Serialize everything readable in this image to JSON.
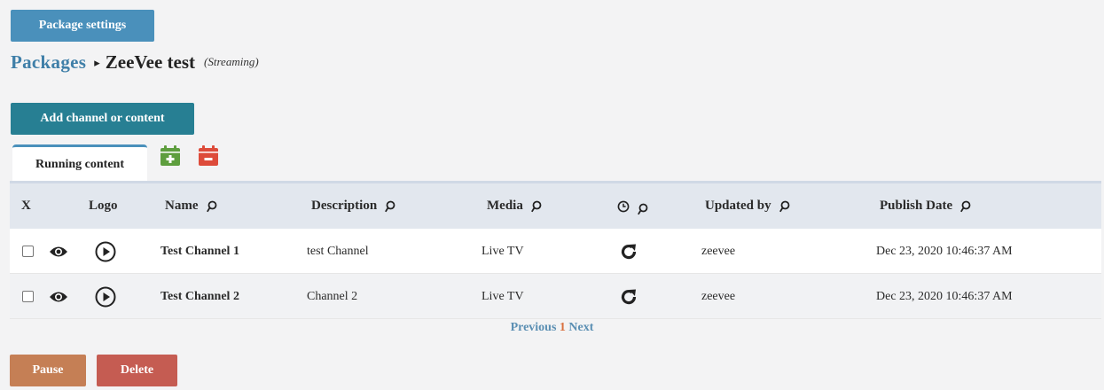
{
  "toolbar": {
    "package_settings_label": "Package settings",
    "add_label": "Add channel or content"
  },
  "breadcrumb": {
    "root": "Packages",
    "separator": "▸",
    "current": "ZeeVee test",
    "type": "(Streaming)"
  },
  "tabs": [
    {
      "label": "Running content",
      "active": true
    }
  ],
  "colors": {
    "primary": "#4a90bb",
    "teal": "#277f93",
    "pause": "#c57f55",
    "delete": "#c55c52",
    "calendar_add": "#5e9e3e",
    "calendar_remove": "#dd4b3a"
  },
  "table": {
    "columns": [
      "X",
      "Logo",
      "Name",
      "Description",
      "Media",
      "",
      "Updated by",
      "Publish Date"
    ],
    "rows": [
      {
        "name": "Test Channel 1",
        "description": "test Channel",
        "media": "Live TV",
        "updated_by": "zeevee",
        "publish_date": "Dec 23, 2020 10:46:37 AM"
      },
      {
        "name": "Test Channel 2",
        "description": "Channel 2",
        "media": "Live TV",
        "updated_by": "zeevee",
        "publish_date": "Dec 23, 2020 10:46:37 AM"
      }
    ]
  },
  "pagination": {
    "previous": "Previous",
    "current": "1",
    "next": "Next"
  },
  "actions": {
    "pause_label": "Pause",
    "delete_label": "Delete"
  },
  "icons": [
    "eye-icon",
    "play-icon",
    "refresh-icon",
    "search-icon",
    "clock-icon",
    "calendar-add-icon",
    "calendar-remove-icon"
  ]
}
